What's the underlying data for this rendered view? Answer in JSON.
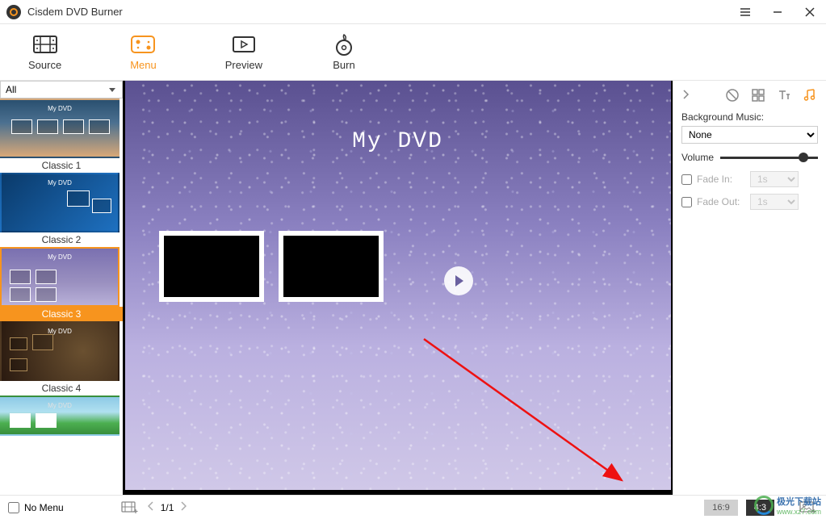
{
  "app": {
    "title": "Cisdem DVD Burner"
  },
  "toolbar": {
    "source": "Source",
    "menu": "Menu",
    "preview": "Preview",
    "burn": "Burn"
  },
  "sidebar": {
    "category": "All",
    "templates": [
      {
        "label": "Classic 1",
        "thumb_title": "My DVD"
      },
      {
        "label": "Classic 2",
        "thumb_title": "My DVD"
      },
      {
        "label": "Classic 3",
        "thumb_title": "My DVD"
      },
      {
        "label": "Classic 4",
        "thumb_title": "My DVD"
      },
      {
        "label": "",
        "thumb_title": "My DVD"
      }
    ],
    "selected_index": 2
  },
  "preview": {
    "title": "My DVD"
  },
  "right": {
    "section": "Background Music:",
    "music_value": "None",
    "volume_label": "Volume",
    "volume_percent": 85,
    "fade_in_label": "Fade In:",
    "fade_in_value": "1s",
    "fade_in_checked": false,
    "fade_out_label": "Fade Out:",
    "fade_out_value": "1s",
    "fade_out_checked": false
  },
  "bottom": {
    "no_menu_label": "No Menu",
    "no_menu_checked": false,
    "page_current": 1,
    "page_total": 1,
    "page_display": "1/1",
    "ratio_wide": "16:9",
    "ratio_std": "4:3",
    "ratio_active": "4:3"
  },
  "watermark": {
    "line1": "极光下载站",
    "line2": "www.xz7.com"
  }
}
